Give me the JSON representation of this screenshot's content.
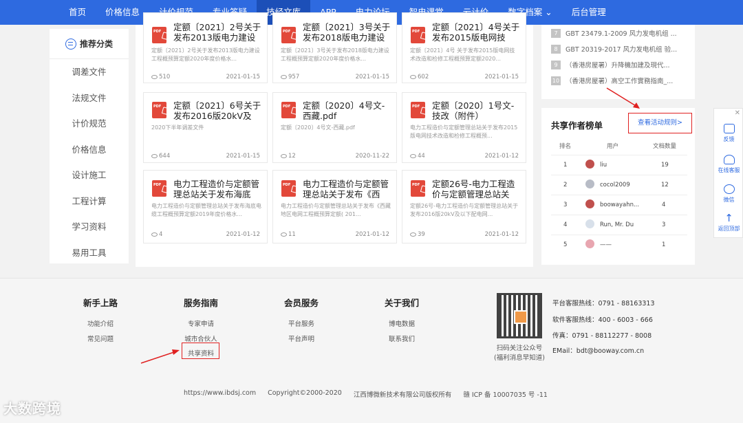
{
  "nav": {
    "items": [
      "首页",
      "价格信息",
      "计价规范",
      "专业答疑",
      "技经文库",
      "APP",
      "电力论坛",
      "智电课堂",
      "云计价",
      "数字档案",
      "后台管理"
    ],
    "active_index": 4,
    "dropdown_index": 9
  },
  "sidebar": {
    "title": "推荐分类",
    "items": [
      "调差文件",
      "法规文件",
      "计价规范",
      "价格信息",
      "设计施工",
      "工程计算",
      "学习资料",
      "易用工具"
    ]
  },
  "docs": [
    {
      "title": "定额〔2021〕2号关于发布2013版电力建设工...",
      "desc": "定额〔2021〕2号关于发布2013版电力建设工程概预算定额2020年度价格水...",
      "views": "510",
      "date": "2021-01-15"
    },
    {
      "title": "定额〔2021〕3号关于发布2018版电力建设工...",
      "desc": "定额〔2021〕3号关于发布2018版电力建设工程概预算定额2020年度价格水...",
      "views": "957",
      "date": "2021-01-15"
    },
    {
      "title": "定额〔2021〕4号关于发布2015版电网技术...",
      "desc": "定额〔2021〕4号 关于发布2015版电网技术改造和检修工程概预算定额2020...",
      "views": "602",
      "date": "2021-01-15"
    },
    {
      "title": "定额〔2021〕6号关于发布2016版20kV及以...",
      "desc": "2020下半年调差文件",
      "views": "644",
      "date": "2021-01-15"
    },
    {
      "title": "定额〔2020〕4号文-西藏.pdf",
      "desc": "定额〔2020〕4号文-西藏.pdf",
      "views": "12",
      "date": "2020-11-22"
    },
    {
      "title": "定额〔2020〕1号文-技改（附件）",
      "desc": "电力工程造价与定额管理总站关于发布2015版电网技术改造和检修工程概预...",
      "views": "44",
      "date": "2021-01-12"
    },
    {
      "title": "电力工程造价与定额管理总站关于发布海底电...",
      "desc": "电力工程造价与定额管理总站关于发布海底电缆工程概预算定额2019年度价格水...",
      "views": "4",
      "date": "2021-01-12"
    },
    {
      "title": "电力工程造价与定额管理总站关于发布《西藏...",
      "desc": "电力工程造价与定额管理总站关于发布《西藏地区电网工程概预算定额( 201...",
      "views": "11",
      "date": "2021-01-12"
    },
    {
      "title": "定额26号-电力工程造价与定额管理总站关于...",
      "desc": "定额26号-电力工程造价与定额管理总站关于发布2016版20kV及以下配电网...",
      "views": "39",
      "date": "2021-01-12"
    }
  ],
  "ranking": [
    {
      "num": "7",
      "text": "GBT 23479.1-2009 风力发电机组 ..."
    },
    {
      "num": "8",
      "text": "GBT 20319-2017 风力发电机组 验..."
    },
    {
      "num": "9",
      "text": "（香港房屋署）升降機加建及現代..."
    },
    {
      "num": "10",
      "text": "（香港房屋署）高空工作實務指南_..."
    }
  ],
  "authors": {
    "title": "共享作者榜单",
    "rules_link": "查看活动规则>",
    "headers": [
      "排名",
      "用户",
      "文档数量"
    ],
    "rows": [
      {
        "rank": "1",
        "user": "liu",
        "count": "19",
        "avatar": "#c0504d"
      },
      {
        "rank": "2",
        "user": "cocol2009",
        "count": "12",
        "avatar": "#b8bcc6"
      },
      {
        "rank": "3",
        "user": "boowayahn...",
        "count": "4",
        "avatar": "#c0504d"
      },
      {
        "rank": "4",
        "user": "Run, Mr. Du",
        "count": "3",
        "avatar": "#d8e0ea"
      },
      {
        "rank": "5",
        "user": "——",
        "count": "1",
        "avatar": "#e8a6b0"
      }
    ]
  },
  "float": {
    "items": [
      "反馈",
      "在线客服",
      "微信",
      "返回顶部"
    ]
  },
  "footer": {
    "columns": [
      {
        "title": "新手上路",
        "links": [
          "功能介绍",
          "常见问题"
        ]
      },
      {
        "title": "服务指南",
        "links": [
          "专家申请",
          "城市合伙人",
          "共享资料"
        ]
      },
      {
        "title": "会员服务",
        "links": [
          "平台服务",
          "平台声明"
        ]
      },
      {
        "title": "关于我们",
        "links": [
          "博电数据",
          "联系我们"
        ]
      }
    ],
    "qr_caption_1": "扫码关注公众号",
    "qr_caption_2": "(福利消息早知道)",
    "contacts": [
      "平台客服热线：0791 - 88163313",
      "软件客服热线：400 - 6003 - 666",
      "传真：0791 - 88112277 - 8008",
      "EMail：bdt@booway.com.cn"
    ],
    "copyright": [
      "https://www.ibdsj.com",
      "Copyright©2000-2020",
      "江西博微新技术有限公司版权所有",
      "赣 ICP 备 10007035 号 -11"
    ]
  },
  "watermark": "大数跨境"
}
